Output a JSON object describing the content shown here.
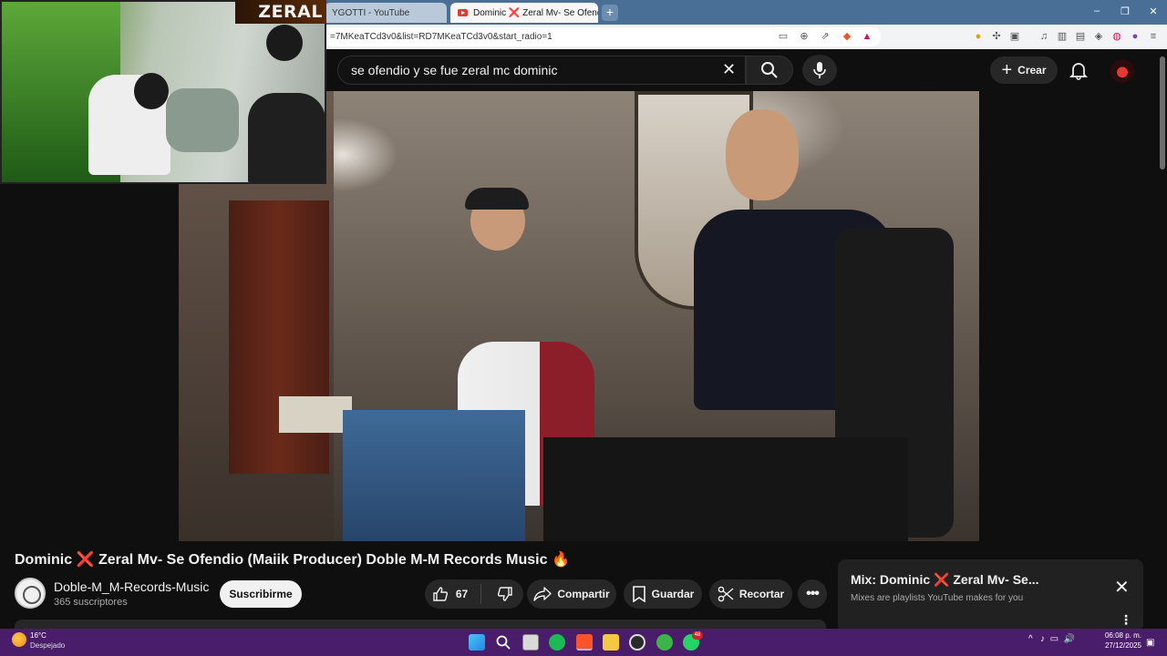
{
  "browser": {
    "tabs": [
      {
        "label": "YGOTTI - YouTube"
      },
      {
        "label": "Dominic ❌ Zeral Mv- Se Ofendio",
        "active": true
      }
    ],
    "new_tab_label": "+",
    "window_controls": {
      "minimize": "–",
      "maximize": "❐",
      "close": "✕"
    },
    "url": "=7MKeaTCd3v0&list=RD7MKeaTCd3v0&start_radio=1"
  },
  "youtube": {
    "search_value": "se ofendio y se fue zeral mc dominic",
    "create_label": "Crear",
    "video": {
      "title_part1": "Dominic",
      "title_x": "❌",
      "title_part2": "Zeral Mv- Se Ofendio (Maiik Producer) Doble M-M Records Music",
      "title_emoji": "🔥",
      "channel_name": "Doble-M_M-Records-Music",
      "subscribers": "365 suscriptores",
      "subscribe_label": "Suscribirme",
      "likes": "67",
      "share_label": "Compartir",
      "save_label": "Guardar",
      "clip_label": "Recortar"
    },
    "mix_panel": {
      "title_part1": "Mix: Dominic",
      "title_x": "❌",
      "title_part2": "Zeral Mv- Se...",
      "subtitle": "Mixes are playlists YouTube makes for you"
    }
  },
  "webcam": {
    "logo_text": "ZERAL"
  },
  "taskbar": {
    "temperature": "16°C",
    "condition": "Despejado",
    "time": "06:08 p. m.",
    "date": "27/12/2025",
    "whatsapp_badge": "48"
  },
  "colors": {
    "tabbar": "#4a6f96",
    "youtube_bg": "#0f0f0f",
    "taskbar": "#4a1d6b"
  }
}
